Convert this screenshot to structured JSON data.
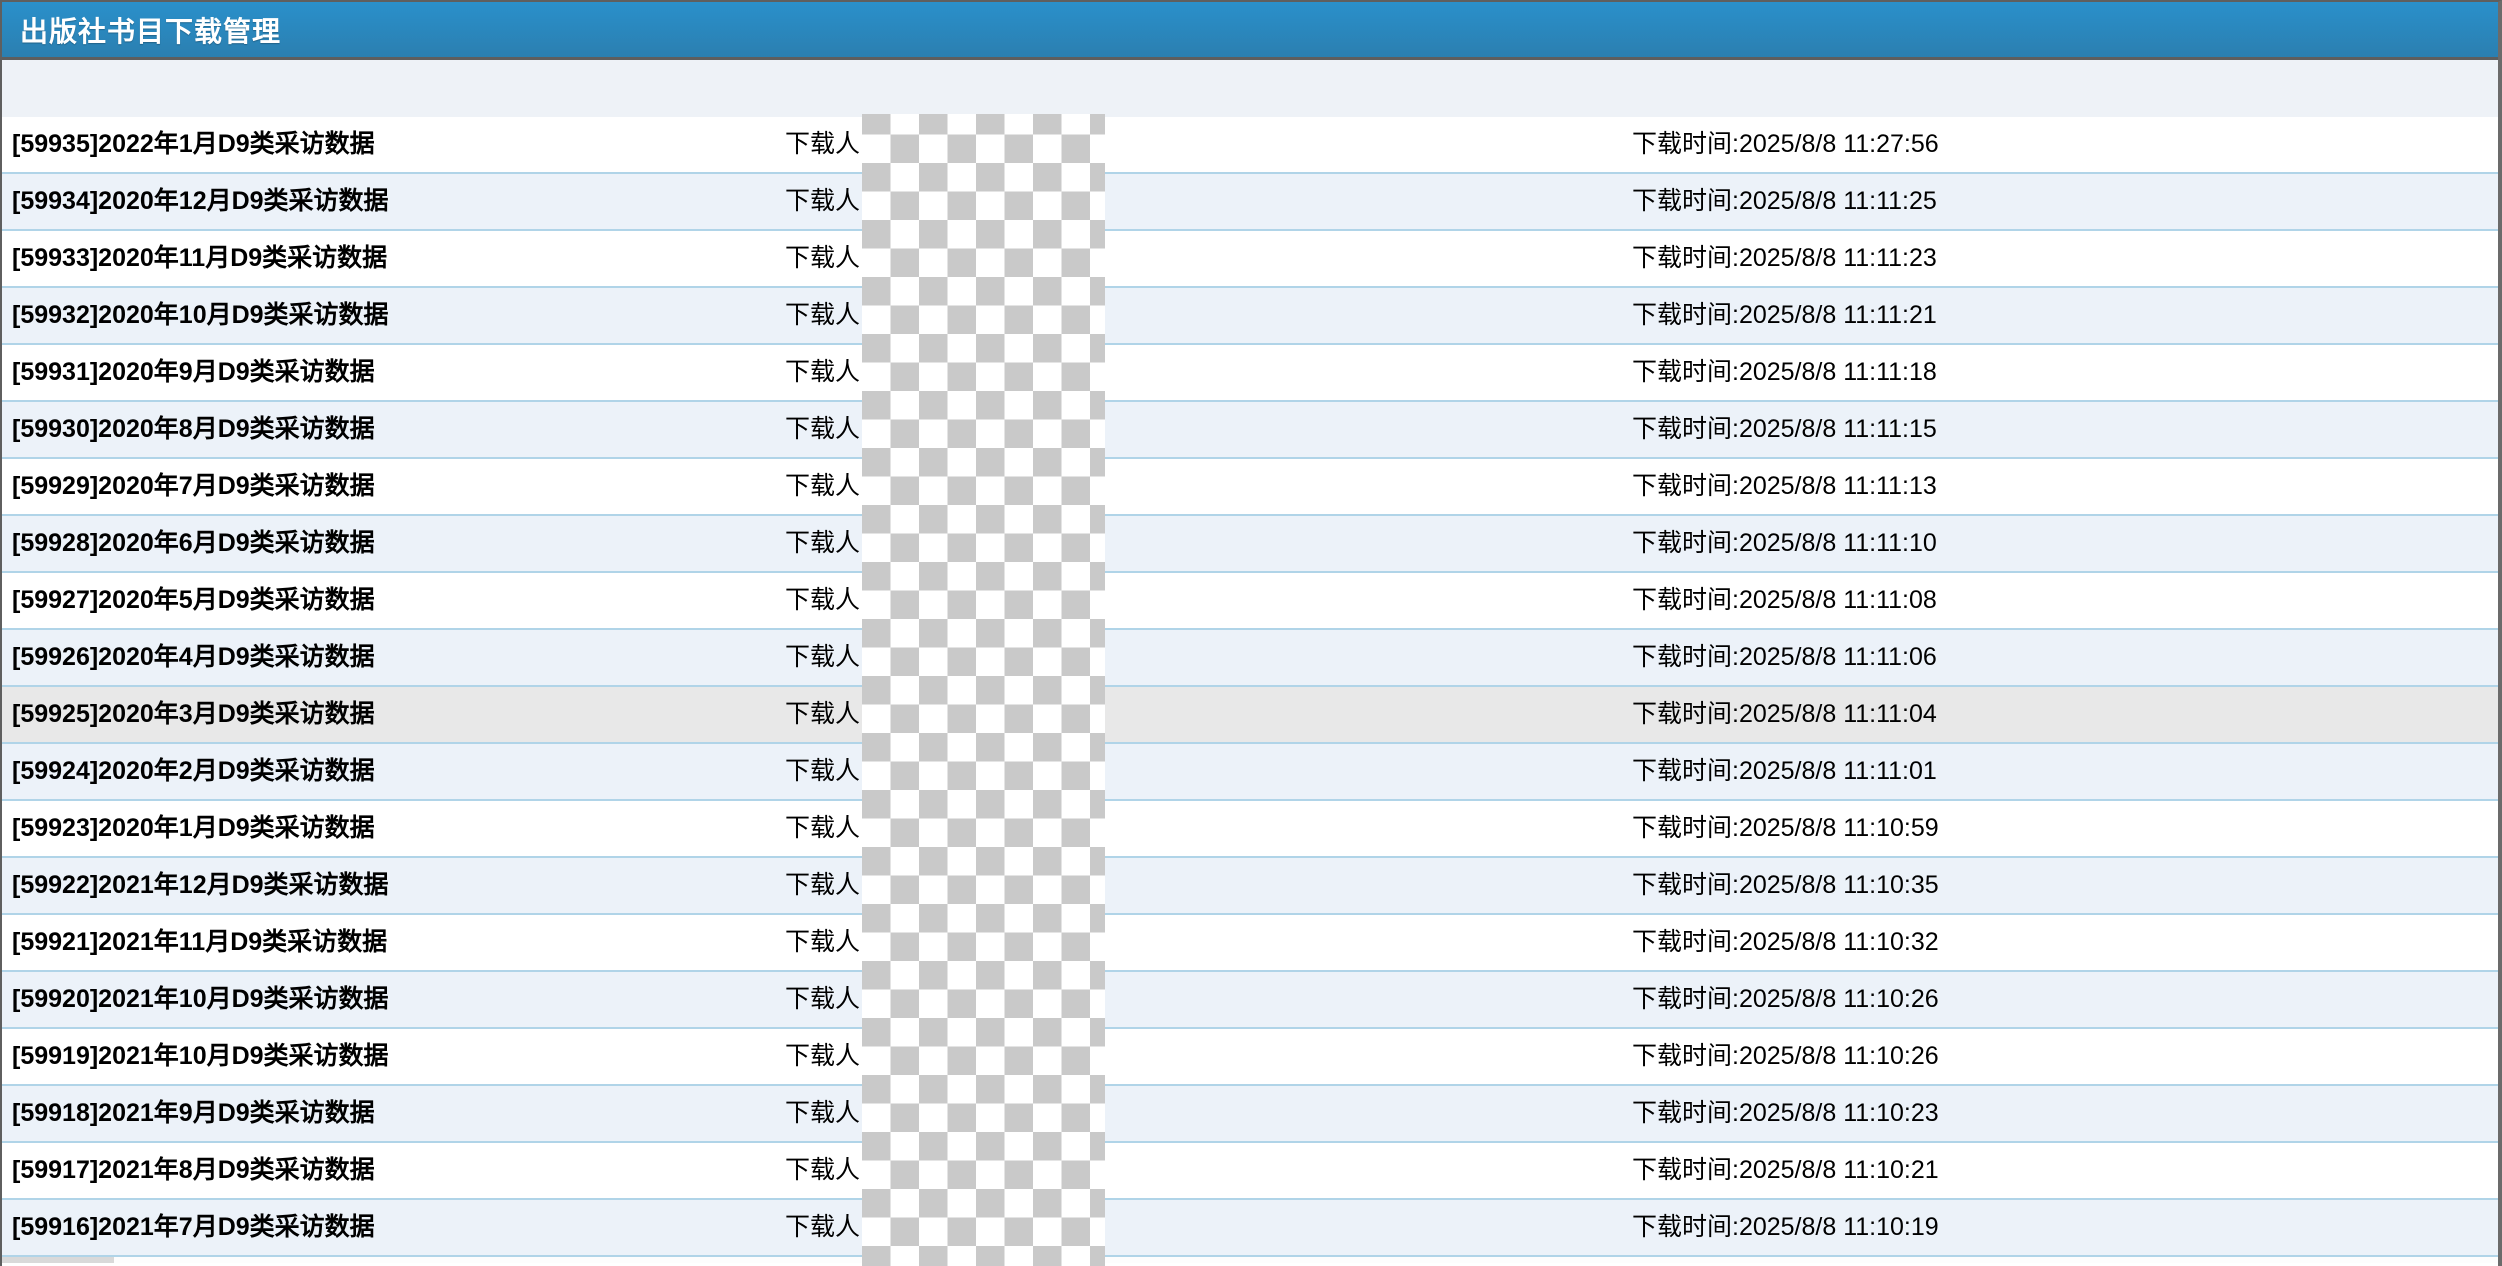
{
  "header": {
    "title": "出版社书目下载管理"
  },
  "list": {
    "downloader_label": "下载人:",
    "time_prefix": "下载时间:",
    "rows": [
      {
        "id": "59935",
        "title": "[59935]2022年1月D9类采访数据",
        "time": "2025/8/8 11:27:56",
        "time_text": "下载时间:2025/8/8 11:27:56",
        "state": "normal"
      },
      {
        "id": "59934",
        "title": "[59934]2020年12月D9类采访数据",
        "time": "2025/8/8 11:11:25",
        "time_text": "下载时间:2025/8/8 11:11:25",
        "state": "normal"
      },
      {
        "id": "59933",
        "title": "[59933]2020年11月D9类采访数据",
        "time": "2025/8/8 11:11:23",
        "time_text": "下载时间:2025/8/8 11:11:23",
        "state": "normal"
      },
      {
        "id": "59932",
        "title": "[59932]2020年10月D9类采访数据",
        "time": "2025/8/8 11:11:21",
        "time_text": "下载时间:2025/8/8 11:11:21",
        "state": "normal"
      },
      {
        "id": "59931",
        "title": "[59931]2020年9月D9类采访数据",
        "time": "2025/8/8 11:11:18",
        "time_text": "下载时间:2025/8/8 11:11:18",
        "state": "normal"
      },
      {
        "id": "59930",
        "title": "[59930]2020年8月D9类采访数据",
        "time": "2025/8/8 11:11:15",
        "time_text": "下载时间:2025/8/8 11:11:15",
        "state": "normal"
      },
      {
        "id": "59929",
        "title": "[59929]2020年7月D9类采访数据",
        "time": "2025/8/8 11:11:13",
        "time_text": "下载时间:2025/8/8 11:11:13",
        "state": "normal"
      },
      {
        "id": "59928",
        "title": "[59928]2020年6月D9类采访数据",
        "time": "2025/8/8 11:11:10",
        "time_text": "下载时间:2025/8/8 11:11:10",
        "state": "normal"
      },
      {
        "id": "59927",
        "title": "[59927]2020年5月D9类采访数据",
        "time": "2025/8/8 11:11:08",
        "time_text": "下载时间:2025/8/8 11:11:08",
        "state": "normal"
      },
      {
        "id": "59926",
        "title": "[59926]2020年4月D9类采访数据",
        "time": "2025/8/8 11:11:06",
        "time_text": "下载时间:2025/8/8 11:11:06",
        "state": "normal"
      },
      {
        "id": "59925",
        "title": "[59925]2020年3月D9类采访数据",
        "time": "2025/8/8 11:11:04",
        "time_text": "下载时间:2025/8/8 11:11:04",
        "state": "hover"
      },
      {
        "id": "59924",
        "title": "[59924]2020年2月D9类采访数据",
        "time": "2025/8/8 11:11:01",
        "time_text": "下载时间:2025/8/8 11:11:01",
        "state": "normal"
      },
      {
        "id": "59923",
        "title": "[59923]2020年1月D9类采访数据",
        "time": "2025/8/8 11:10:59",
        "time_text": "下载时间:2025/8/8 11:10:59",
        "state": "normal"
      },
      {
        "id": "59922",
        "title": "[59922]2021年12月D9类采访数据",
        "time": "2025/8/8 11:10:35",
        "time_text": "下载时间:2025/8/8 11:10:35",
        "state": "normal"
      },
      {
        "id": "59921",
        "title": "[59921]2021年11月D9类采访数据",
        "time": "2025/8/8 11:10:32",
        "time_text": "下载时间:2025/8/8 11:10:32",
        "state": "normal"
      },
      {
        "id": "59920",
        "title": "[59920]2021年10月D9类采访数据",
        "time": "2025/8/8 11:10:26",
        "time_text": "下载时间:2025/8/8 11:10:26",
        "state": "normal"
      },
      {
        "id": "59919",
        "title": "[59919]2021年10月D9类采访数据",
        "time": "2025/8/8 11:10:26",
        "time_text": "下载时间:2025/8/8 11:10:26",
        "state": "normal"
      },
      {
        "id": "59918",
        "title": "[59918]2021年9月D9类采访数据",
        "time": "2025/8/8 11:10:23",
        "time_text": "下载时间:2025/8/8 11:10:23",
        "state": "normal"
      },
      {
        "id": "59917",
        "title": "[59917]2021年8月D9类采访数据",
        "time": "2025/8/8 11:10:21",
        "time_text": "下载时间:2025/8/8 11:10:21",
        "state": "normal"
      },
      {
        "id": "59916",
        "title": "[59916]2021年7月D9类采访数据",
        "time": "2025/8/8 11:10:19",
        "time_text": "下载时间:2025/8/8 11:10:19",
        "state": "normal"
      }
    ]
  },
  "colors": {
    "header_gradient_top": "#2a90cb",
    "header_gradient_bottom": "#2b7fb0",
    "header_border": "#5e5e5e",
    "toolbar_bg": "#eef2f7",
    "row_bg": "#ffffff",
    "row_alt_bg": "#ecf2f9",
    "row_hover_bg": "#e8e8e8",
    "row_divider": "#b0d4e8",
    "redaction_checker_gray": "#c9c9c9",
    "redaction_checker_white": "#ffffff"
  }
}
